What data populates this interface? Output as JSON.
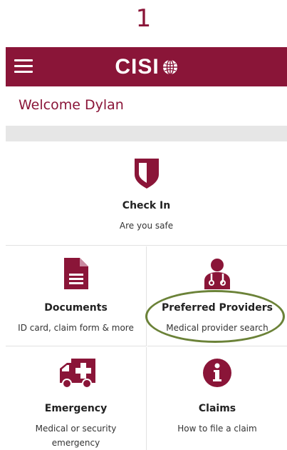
{
  "step": {
    "number": "1"
  },
  "appbar": {
    "brand": "CISI",
    "menu_icon": "hamburger-menu-icon",
    "brand_icon": "globe-icon"
  },
  "welcome": {
    "text": "Welcome Dylan"
  },
  "tiles": {
    "checkin": {
      "title": "Check In",
      "subtitle": "Are you safe",
      "icon": "shield-icon"
    },
    "documents": {
      "title": "Documents",
      "subtitle": "ID card, claim form & more",
      "icon": "document-icon"
    },
    "providers": {
      "title": "Preferred Providers",
      "subtitle": "Medical provider search",
      "icon": "doctor-icon"
    },
    "emergency": {
      "title": "Emergency",
      "subtitle_line1": "Medical or security",
      "subtitle_line2": "emergency",
      "icon": "ambulance-icon"
    },
    "claims": {
      "title": "Claims",
      "subtitle": "How to file a claim",
      "icon": "info-icon"
    }
  },
  "colors": {
    "brand": "#8a1538",
    "highlight": "#6b8238",
    "band": "#e6e6e6"
  }
}
